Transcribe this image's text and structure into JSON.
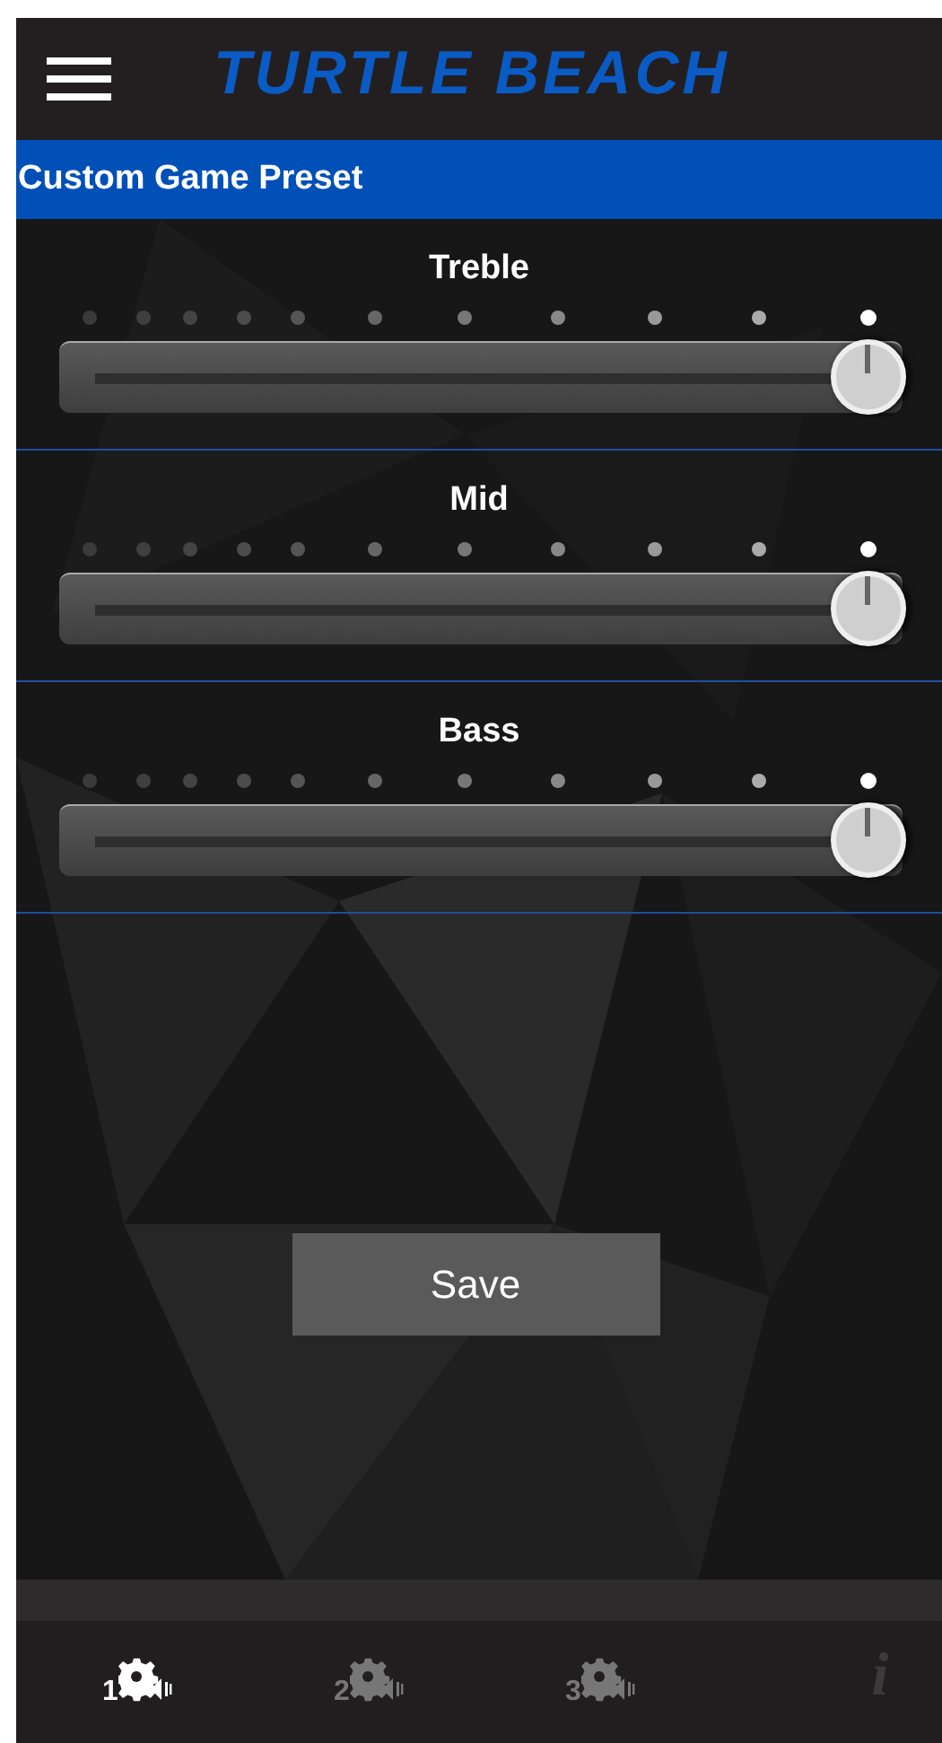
{
  "header": {
    "logo": "TURTLE BEACH"
  },
  "title_bar": {
    "title": "Custom Game Preset"
  },
  "sliders": [
    {
      "label": "Treble",
      "level": 1
    },
    {
      "label": "Mid",
      "level": 1
    },
    {
      "label": "Bass",
      "level": 1
    }
  ],
  "save_button": {
    "label": "Save"
  },
  "bottom_nav": [
    {
      "kind": "preset",
      "label": "1",
      "selected": true
    },
    {
      "kind": "preset",
      "label": "2",
      "selected": false
    },
    {
      "kind": "preset",
      "label": "3",
      "selected": false
    },
    {
      "kind": "info",
      "label": "i",
      "selected": false
    }
  ]
}
